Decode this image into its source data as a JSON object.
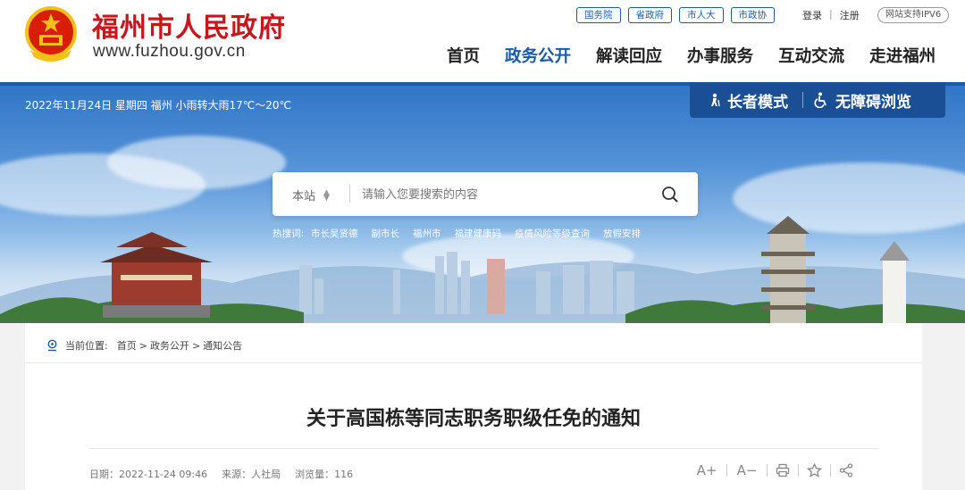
{
  "header": {
    "site_title": "福州市人民政府",
    "site_url": "www.fuzhou.gov.cn",
    "top_links": [
      "国务院",
      "省政府",
      "市人大",
      "市政协"
    ],
    "login": "登录",
    "register": "注册",
    "divider": "|",
    "ipv6": "网站支持IPV6",
    "nav": [
      "首页",
      "政务公开",
      "解读回应",
      "办事服务",
      "互动交流",
      "走进福州"
    ],
    "active_nav": "政务公开"
  },
  "banner": {
    "date_weather": "2022年11月24日 星期四 福州 小雨转大雨17℃～20℃",
    "elder_mode": "长者模式",
    "accessible": "无障碍浏览",
    "search": {
      "scope": "本站",
      "placeholder": "请输入您要搜索的内容"
    },
    "hot_label": "热搜词:",
    "hot_words": [
      "市长吴贤德",
      "副市长",
      "福州市",
      "福建健康码",
      "疫情风险等级查询",
      "放假安排"
    ]
  },
  "breadcrumb": {
    "label": "当前位置:",
    "items": [
      "首页",
      "政务公开",
      "通知公告"
    ],
    "sep": ">"
  },
  "article": {
    "title": "关于高国栋等同志职务职级任免的通知",
    "date": "日期：2022-11-24 09:46",
    "source": "来源：人社局",
    "views": "浏览量：116"
  },
  "tools": {
    "font_up": "A+",
    "font_down": "A−"
  },
  "icons": [
    "national-emblem-icon",
    "elder-person-icon",
    "wheelchair-icon",
    "search-icon",
    "location-pin-icon",
    "print-icon",
    "star-icon",
    "share-icon"
  ],
  "colors": {
    "brand_red": "#c8161d",
    "brand_blue": "#1a5aa8",
    "elder_bar": "#1a4f95"
  }
}
